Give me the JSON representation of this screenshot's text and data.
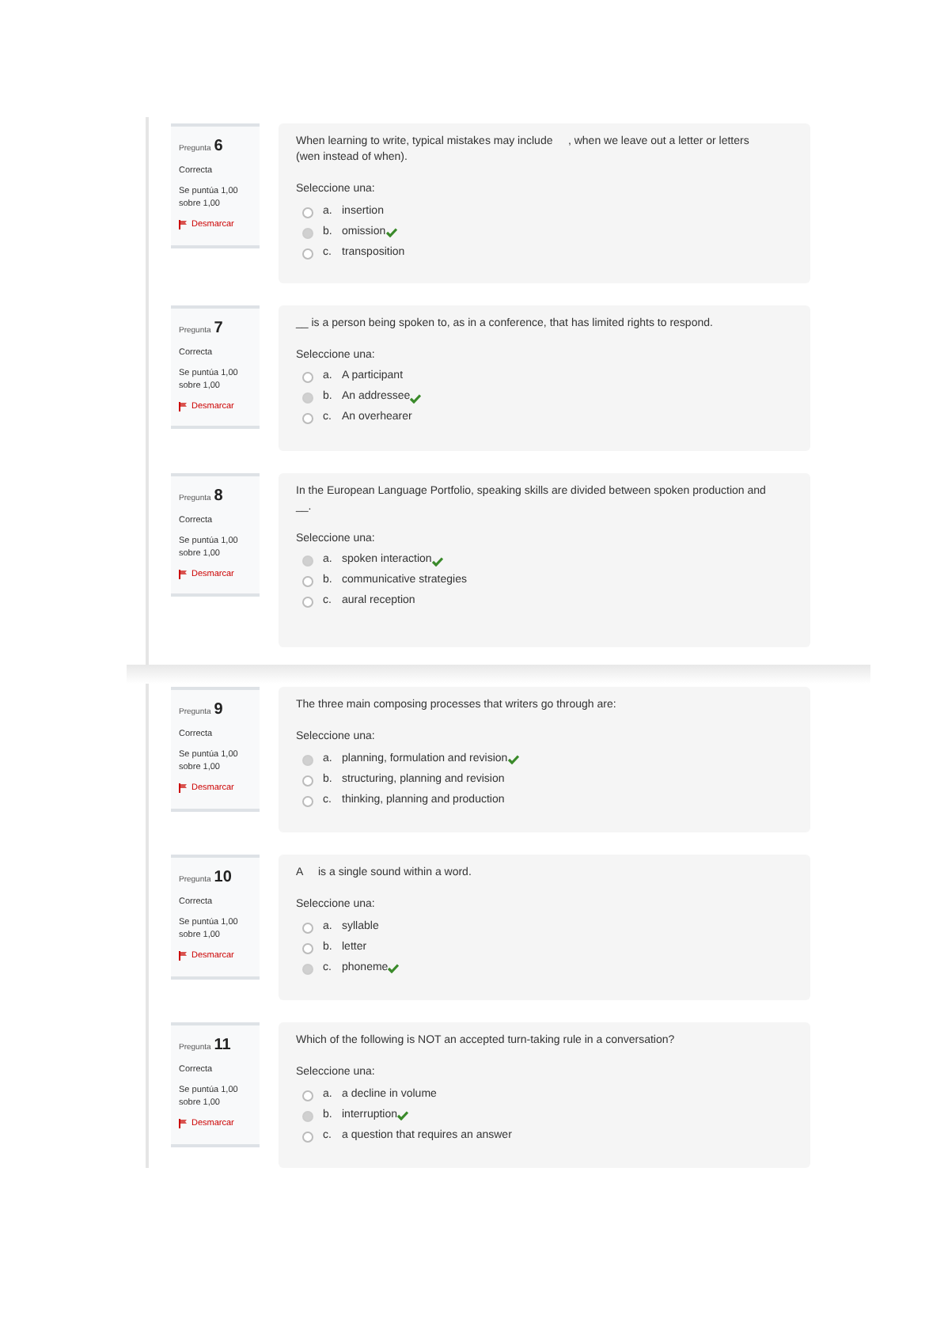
{
  "pages": [
    {
      "questions": [
        {
          "label": "Pregunta",
          "number": "6",
          "state": "Correcta",
          "score": "Se puntúa 1,00 sobre 1,00",
          "flag": "Desmarcar",
          "text": "When learning to write, typical mistakes may include     , when we leave out a letter or letters (wen instead of when).",
          "prompt": "Seleccione una:",
          "options": [
            {
              "letter": "a.",
              "text": "insertion",
              "selected": false,
              "correct": false
            },
            {
              "letter": "b.",
              "text": "omission",
              "selected": true,
              "correct": true
            },
            {
              "letter": "c.",
              "text": "transposition",
              "selected": false,
              "correct": false
            }
          ]
        },
        {
          "label": "Pregunta",
          "number": "7",
          "state": "Correcta",
          "score": "Se puntúa 1,00 sobre 1,00",
          "flag": "Desmarcar",
          "text": "__ is a person being spoken to, as in a conference, that has limited rights to respond.",
          "prompt": "Seleccione una:",
          "options": [
            {
              "letter": "a.",
              "text": "A participant",
              "selected": false,
              "correct": false
            },
            {
              "letter": "b.",
              "text": "An addressee",
              "selected": true,
              "correct": true
            },
            {
              "letter": "c.",
              "text": "An overhearer",
              "selected": false,
              "correct": false
            }
          ]
        },
        {
          "label": "Pregunta",
          "number": "8",
          "state": "Correcta",
          "score": "Se puntúa 1,00 sobre 1,00",
          "flag": "Desmarcar",
          "text": "In the European Language Portfolio, speaking skills are divided between spoken production and __.",
          "prompt": "Seleccione una:",
          "options": [
            {
              "letter": "a.",
              "text": "spoken interaction",
              "selected": true,
              "correct": true
            },
            {
              "letter": "b.",
              "text": "communicative strategies",
              "selected": false,
              "correct": false
            },
            {
              "letter": "c.",
              "text": "aural reception",
              "selected": false,
              "correct": false
            }
          ]
        }
      ]
    },
    {
      "questions": [
        {
          "label": "Pregunta",
          "number": "9",
          "state": "Correcta",
          "score": "Se puntúa 1,00 sobre 1,00",
          "flag": "Desmarcar",
          "text": "The three main composing processes that writers go through are:",
          "prompt": "Seleccione una:",
          "options": [
            {
              "letter": "a.",
              "text": "planning, formulation and revision",
              "selected": true,
              "correct": true
            },
            {
              "letter": "b.",
              "text": "structuring, planning and revision",
              "selected": false,
              "correct": false
            },
            {
              "letter": "c.",
              "text": "thinking, planning and production",
              "selected": false,
              "correct": false
            }
          ]
        },
        {
          "label": "Pregunta",
          "number": "10",
          "state": "Correcta",
          "score": "Se puntúa 1,00 sobre 1,00",
          "flag": "Desmarcar",
          "text": "A     is a single sound within a word.",
          "prompt": "Seleccione una:",
          "options": [
            {
              "letter": "a.",
              "text": "syllable",
              "selected": false,
              "correct": false
            },
            {
              "letter": "b.",
              "text": "letter",
              "selected": false,
              "correct": false
            },
            {
              "letter": "c.",
              "text": "phoneme",
              "selected": true,
              "correct": true
            }
          ]
        },
        {
          "label": "Pregunta",
          "number": "11",
          "state": "Correcta",
          "score": "Se puntúa 1,00 sobre 1,00",
          "flag": "Desmarcar",
          "text": "Which of the following is NOT an accepted turn-taking rule in a conversation?",
          "prompt": "Seleccione una:",
          "options": [
            {
              "letter": "a.",
              "text": "a decline in volume",
              "selected": false,
              "correct": false
            },
            {
              "letter": "b.",
              "text": "interruption",
              "selected": true,
              "correct": true
            },
            {
              "letter": "c.",
              "text": "a question that requires an answer",
              "selected": false,
              "correct": false
            }
          ]
        }
      ]
    }
  ]
}
